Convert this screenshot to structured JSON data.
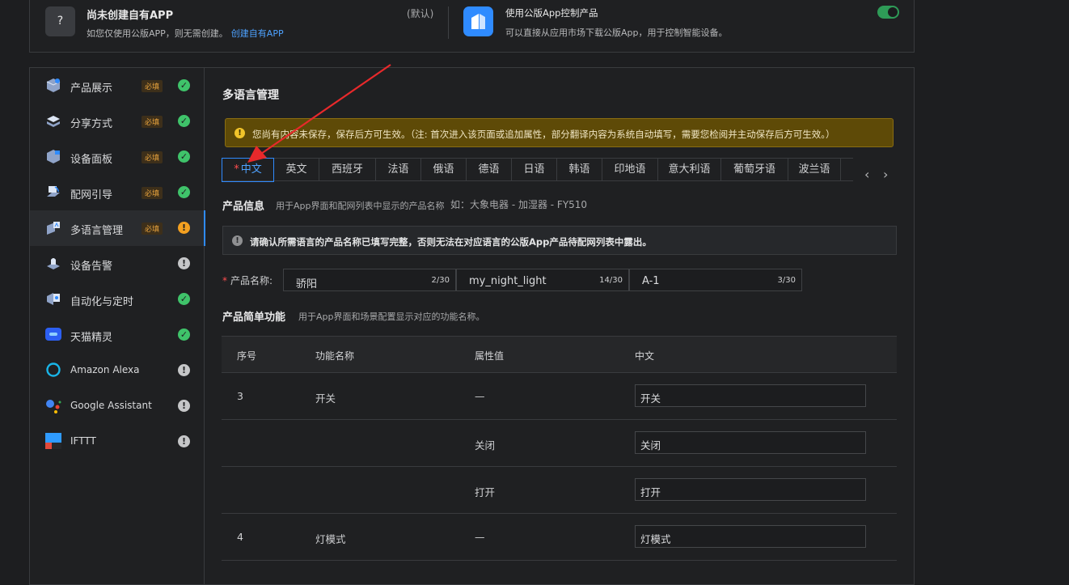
{
  "top_card": {
    "question_mark": "?",
    "title": "尚未创建自有APP",
    "subtitle": "如您仅使用公版APP，则无需创建。",
    "create_link": "创建自有APP",
    "default_tag": "(默认)",
    "public_app_title": "使用公版App控制产品",
    "public_app_desc": "可以直接从应用市场下载公版App，用于控制智能设备。"
  },
  "sidebar": {
    "items": [
      {
        "label": "产品展示",
        "required": "必填",
        "status": "ok"
      },
      {
        "label": "分享方式",
        "required": "必填",
        "status": "ok"
      },
      {
        "label": "设备面板",
        "required": "必填",
        "status": "ok"
      },
      {
        "label": "配网引导",
        "required": "必填",
        "status": "ok"
      },
      {
        "label": "多语言管理",
        "required": "必填",
        "status": "warn"
      },
      {
        "label": "设备告警",
        "required": "",
        "status": "gray"
      },
      {
        "label": "自动化与定时",
        "required": "",
        "status": "ok"
      },
      {
        "label": "天猫精灵",
        "required": "",
        "status": "ok"
      },
      {
        "label": "Amazon Alexa",
        "required": "",
        "status": "gray"
      },
      {
        "label": "Google Assistant",
        "required": "",
        "status": "gray"
      },
      {
        "label": "IFTTT",
        "required": "",
        "status": "gray"
      }
    ],
    "status_glyphs": {
      "ok": "✓",
      "warn": "!",
      "gray": "!"
    }
  },
  "content": {
    "title": "多语言管理",
    "unsaved_warning": "您尚有内容未保存，保存后方可生效。（注: 首次进入该页面或追加属性，部分翻译内容为系统自动填写，需要您检阅并主动保存后方可生效。）",
    "tabs": [
      "中文",
      "英文",
      "西班牙",
      "法语",
      "俄语",
      "德语",
      "日语",
      "韩语",
      "印地语",
      "意大利语",
      "葡萄牙语",
      "波兰语"
    ],
    "active_tab_star": "*",
    "tab_prev": "‹",
    "tab_next": "›",
    "product_info": {
      "title": "产品信息",
      "desc": "用于App界面和配网列表中显示的产品名称",
      "example": "如：大象电器 - 加湿器 - FY510"
    },
    "info_notice": "请确认所需语言的产品名称已填写完整，否则无法在对应语言的公版App产品待配网列表中露出。",
    "product_name": {
      "label": "产品名称:",
      "star": "*",
      "inputs": [
        {
          "value": "骄阳",
          "count": "2/30"
        },
        {
          "value": "my_night_light",
          "count": "14/30"
        },
        {
          "value": "A-1",
          "count": "3/30"
        }
      ]
    },
    "simple_function": {
      "title": "产品简单功能",
      "desc": "用于App界面和场景配置显示对应的功能名称。"
    },
    "table": {
      "headers": [
        "序号",
        "功能名称",
        "属性值",
        "中文"
      ],
      "rows": [
        {
          "index": "3",
          "name": "开关",
          "value": "—",
          "zh": "开关"
        },
        {
          "index": "",
          "name": "",
          "value": "关闭",
          "zh": "关闭"
        },
        {
          "index": "",
          "name": "",
          "value": "打开",
          "zh": "打开"
        },
        {
          "index": "4",
          "name": "灯模式",
          "value": "—",
          "zh": "灯模式"
        }
      ]
    }
  },
  "colors": {
    "accent": "#2f8bff",
    "warning_bg": "#5e4a07",
    "ok_green": "#3fc36a",
    "warn_orange": "#f3a020",
    "annotation_arrow": "#e8292b"
  }
}
